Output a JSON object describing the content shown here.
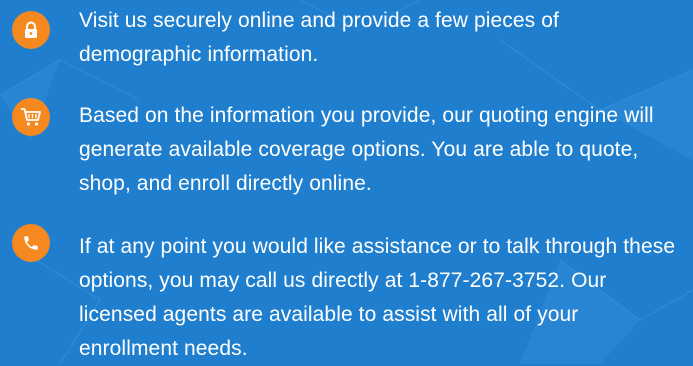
{
  "steps": [
    {
      "icon": "lock-icon",
      "text": "Visit us securely online and provide a few pieces of demographic information."
    },
    {
      "icon": "shopping-cart-icon",
      "text": "Based on the information you provide, our quoting engine will generate available coverage options. You are able to quote, shop, and enroll directly online."
    },
    {
      "icon": "phone-icon",
      "text": "If at any point you would like assistance or to talk through these options, you may call us directly at 1-877-267-3752. Our licensed agents are available to assist with all of your enrollment needs."
    }
  ],
  "colors": {
    "background": "#1f7fce",
    "icon_circle": "#f5891f",
    "text": "#ffffff"
  }
}
